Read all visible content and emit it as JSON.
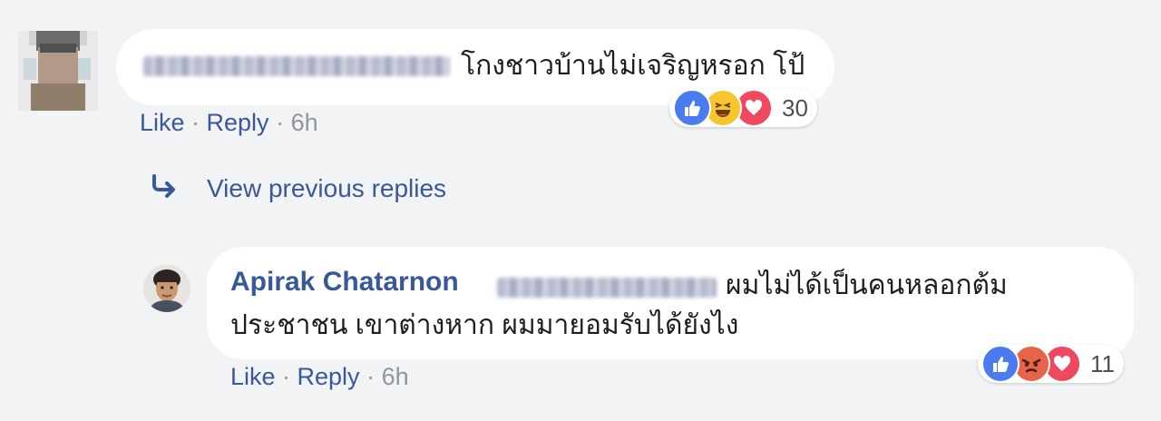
{
  "comment": {
    "text": "โกงชาวบ้านไม่เจริญหรอก โป้",
    "meta": {
      "like": "Like",
      "sep1": " · ",
      "reply": "Reply",
      "sep2": " · ",
      "time": "6h"
    },
    "reactions": {
      "icons": [
        "like-icon",
        "haha-icon",
        "love-icon"
      ],
      "count": "30"
    }
  },
  "view_previous_replies": {
    "label": "View previous replies",
    "icon": "reply-arrow-icon"
  },
  "reply": {
    "author": "Apirak Chatarnon",
    "text_line1": "ผมไม่ได้เป็นคนหลอกต้ม",
    "text_line2": "ประชาชน เขาต่างหาก ผมมายอมรับได้ยังไง",
    "meta": {
      "like": "Like",
      "sep1": " · ",
      "reply": "Reply",
      "sep2": " · ",
      "time": "6h"
    },
    "reactions": {
      "icons": [
        "like-icon",
        "angry-icon",
        "love-icon"
      ],
      "count": "11"
    }
  },
  "colors": {
    "background": "#f2f3f5",
    "bubble": "#ffffff",
    "link": "#385898",
    "muted": "#90949c",
    "like": "#4a7cf0",
    "love": "#f0485e",
    "haha": "#f7c62f",
    "angry": "#e6654a"
  }
}
